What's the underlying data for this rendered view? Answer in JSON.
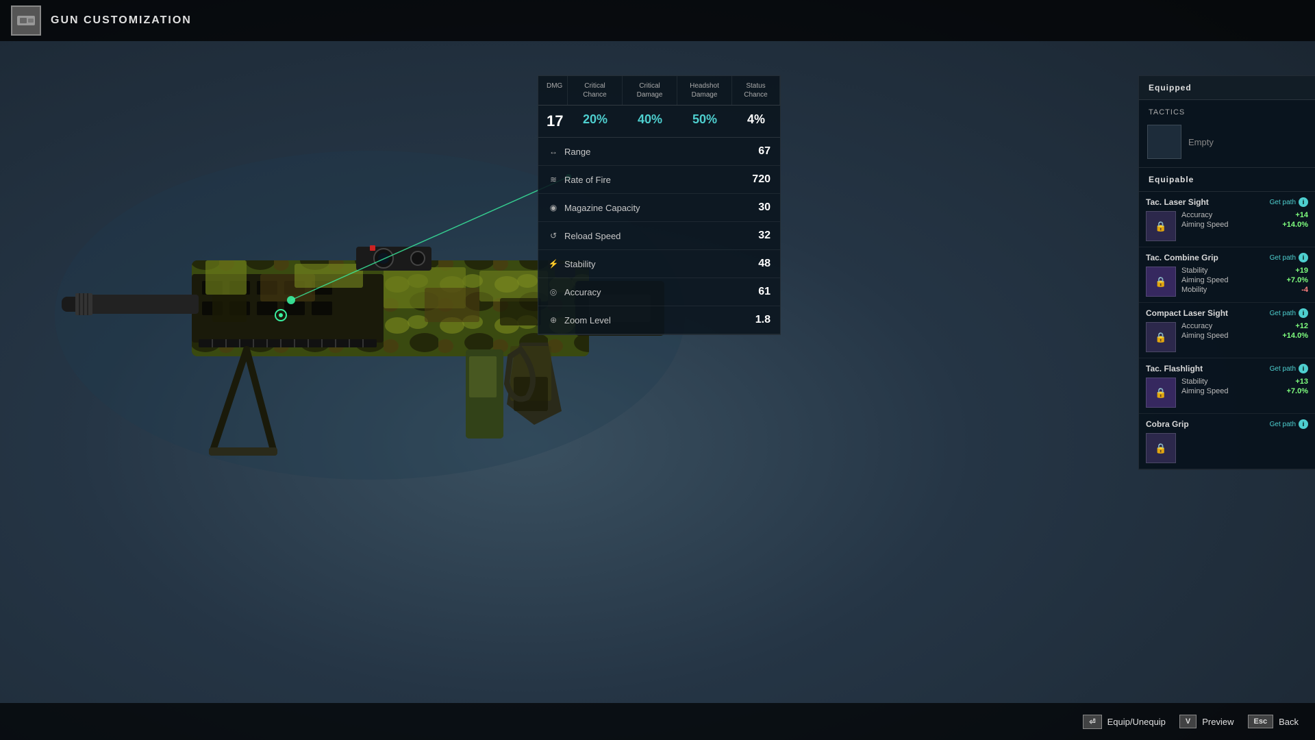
{
  "header": {
    "title": "GUN CUSTOMIZATION",
    "icon": "⚙"
  },
  "stats": {
    "columns": {
      "dmg_label": "DMG",
      "critical_chance_label": "Critical Chance",
      "critical_damage_label": "Critical Damage",
      "headshot_damage_label": "Headshot Damage",
      "status_chance_label": "Status Chance"
    },
    "values": {
      "dmg": "17",
      "critical_chance": "20%",
      "critical_damage": "40%",
      "headshot_damage": "50%",
      "status_chance": "4%"
    },
    "rows": [
      {
        "icon": "↔",
        "label": "Range",
        "value": "67"
      },
      {
        "icon": "≋",
        "label": "Rate of Fire",
        "value": "720"
      },
      {
        "icon": "◉",
        "label": "Magazine Capacity",
        "value": "30"
      },
      {
        "icon": "↺",
        "label": "Reload Speed",
        "value": "32"
      },
      {
        "icon": "⚡",
        "label": "Stability",
        "value": "48"
      },
      {
        "icon": "◎",
        "label": "Accuracy",
        "value": "61"
      },
      {
        "icon": "⊕",
        "label": "Zoom Level",
        "value": "1.8"
      }
    ]
  },
  "equipped_panel": {
    "header": "Equipped",
    "tactics_label": "TACTICS",
    "tactics_slot_empty": "Empty"
  },
  "equipable_panel": {
    "header": "Equipable",
    "items": [
      {
        "name": "Tac. Laser Sight",
        "get_path": "Get path",
        "stats": [
          {
            "label": "Accuracy",
            "value": "+14",
            "type": "positive"
          },
          {
            "label": "Aiming Speed",
            "value": "+14.0%",
            "type": "positive"
          }
        ]
      },
      {
        "name": "Tac. Combine Grip",
        "get_path": "Get path",
        "stats": [
          {
            "label": "Stability",
            "value": "+19",
            "type": "positive"
          },
          {
            "label": "Aiming Speed",
            "value": "+7.0%",
            "type": "positive"
          },
          {
            "label": "Mobility",
            "value": "-4",
            "type": "negative"
          }
        ]
      },
      {
        "name": "Compact Laser Sight",
        "get_path": "Get path",
        "stats": [
          {
            "label": "Accuracy",
            "value": "+12",
            "type": "positive"
          },
          {
            "label": "Aiming Speed",
            "value": "+14.0%",
            "type": "positive"
          }
        ]
      },
      {
        "name": "Tac. Flashlight",
        "get_path": "Get path",
        "stats": [
          {
            "label": "Stability",
            "value": "+13",
            "type": "positive"
          },
          {
            "label": "Aiming Speed",
            "value": "+7.0%",
            "type": "positive"
          }
        ]
      },
      {
        "name": "Cobra Grip",
        "get_path": "Get path",
        "stats": []
      }
    ]
  },
  "bottom_actions": [
    {
      "key": "⏎",
      "label": "Equip/Unequip"
    },
    {
      "key": "V",
      "label": "Preview"
    },
    {
      "key": "Esc",
      "label": "Back"
    }
  ]
}
